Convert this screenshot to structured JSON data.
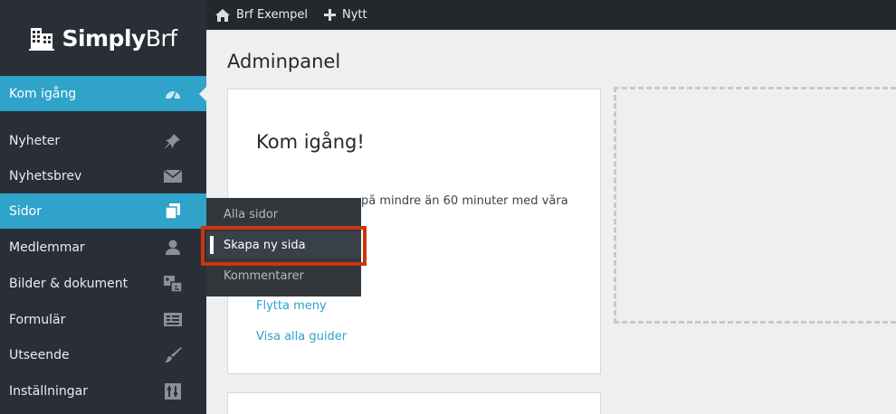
{
  "logo": {
    "bold": "Simply",
    "light": "Brf"
  },
  "topbar": {
    "site_name": "Brf Exempel",
    "new_label": "Nytt"
  },
  "sidebar": {
    "items": [
      {
        "label": "Kom igång",
        "icon": "dashboard-icon"
      },
      {
        "label": "Nyheter",
        "icon": "pin-icon"
      },
      {
        "label": "Nyhetsbrev",
        "icon": "envelope-icon"
      },
      {
        "label": "Sidor",
        "icon": "pages-icon"
      },
      {
        "label": "Medlemmar",
        "icon": "user-icon"
      },
      {
        "label": "Bilder & dokument",
        "icon": "media-icon"
      },
      {
        "label": "Formulär",
        "icon": "form-icon"
      },
      {
        "label": "Utseende",
        "icon": "brush-icon"
      },
      {
        "label": "Inställningar",
        "icon": "settings-icon"
      }
    ]
  },
  "flyout": {
    "items": [
      {
        "label": "Alla sidor"
      },
      {
        "label": "Skapa ny sida"
      },
      {
        "label": "Kommentarer"
      }
    ]
  },
  "main": {
    "title": "Adminpanel",
    "card": {
      "title": "Kom igång!",
      "intro": "på mindre än 60 minuter med våra",
      "links": [
        "Flytta meny",
        "Visa alla guider"
      ]
    }
  },
  "colors": {
    "accent": "#2fa3c9",
    "sidebar_bg": "#2a2f37",
    "topbar_bg": "#23282d",
    "highlight": "#c8370f"
  }
}
